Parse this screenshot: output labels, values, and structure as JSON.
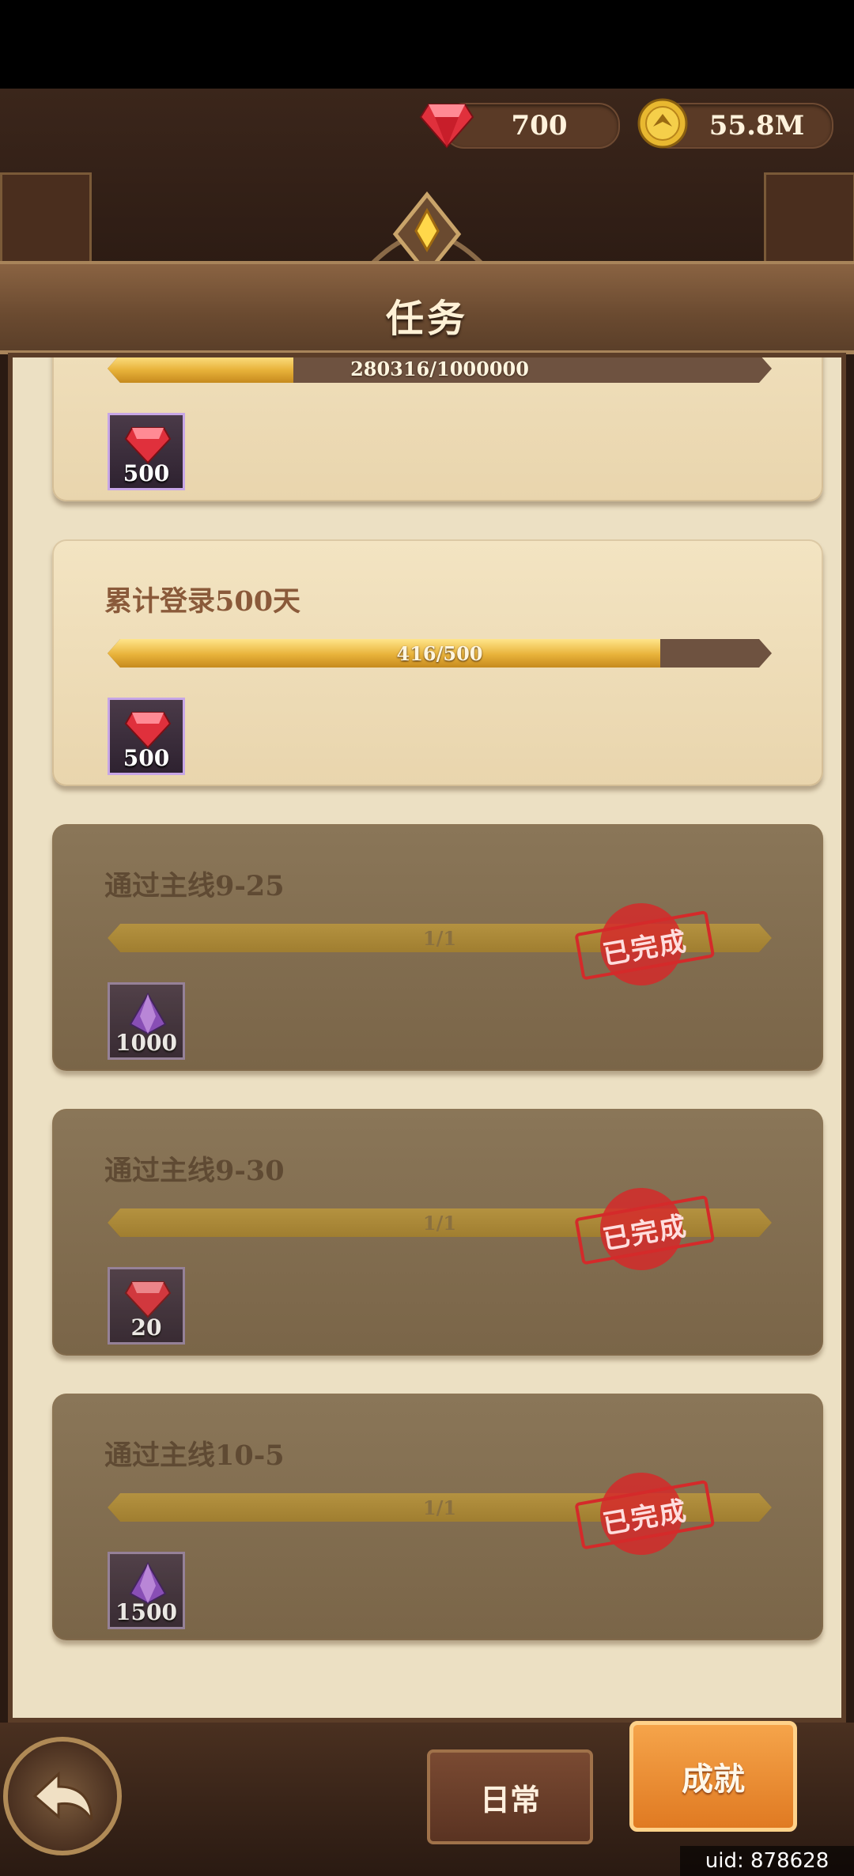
{
  "resources": {
    "gems": "700",
    "gold": "55.8M"
  },
  "header": {
    "title": "任务"
  },
  "tasks": [
    {
      "title": "",
      "progress_text": "280316/1000000",
      "progress": 0.28,
      "reward_icon": "red-gem-icon",
      "reward_amount": "500",
      "completed": false
    },
    {
      "title": "累计登录500天",
      "progress_text": "416/500",
      "progress": 0.832,
      "reward_icon": "red-gem-icon",
      "reward_amount": "500",
      "completed": false
    },
    {
      "title": "通过主线9-25",
      "progress_text": "1/1",
      "progress": 1.0,
      "reward_icon": "purple-crystal-icon",
      "reward_amount": "1000",
      "completed": true,
      "stamp": "已完成"
    },
    {
      "title": "通过主线9-30",
      "progress_text": "1/1",
      "progress": 1.0,
      "reward_icon": "red-gem-icon",
      "reward_amount": "20",
      "completed": true,
      "stamp": "已完成"
    },
    {
      "title": "通过主线10-5",
      "progress_text": "1/1",
      "progress": 1.0,
      "reward_icon": "purple-crystal-icon",
      "reward_amount": "1500",
      "completed": true,
      "stamp": "已完成"
    }
  ],
  "tabs": {
    "daily": "日常",
    "achievement": "成就"
  },
  "footer": {
    "uid": "uid: 878628"
  },
  "colors": {
    "progress_gold": "#e8b23a",
    "stamp_red": "#d42a2a",
    "active_tab": "#e07a22"
  }
}
